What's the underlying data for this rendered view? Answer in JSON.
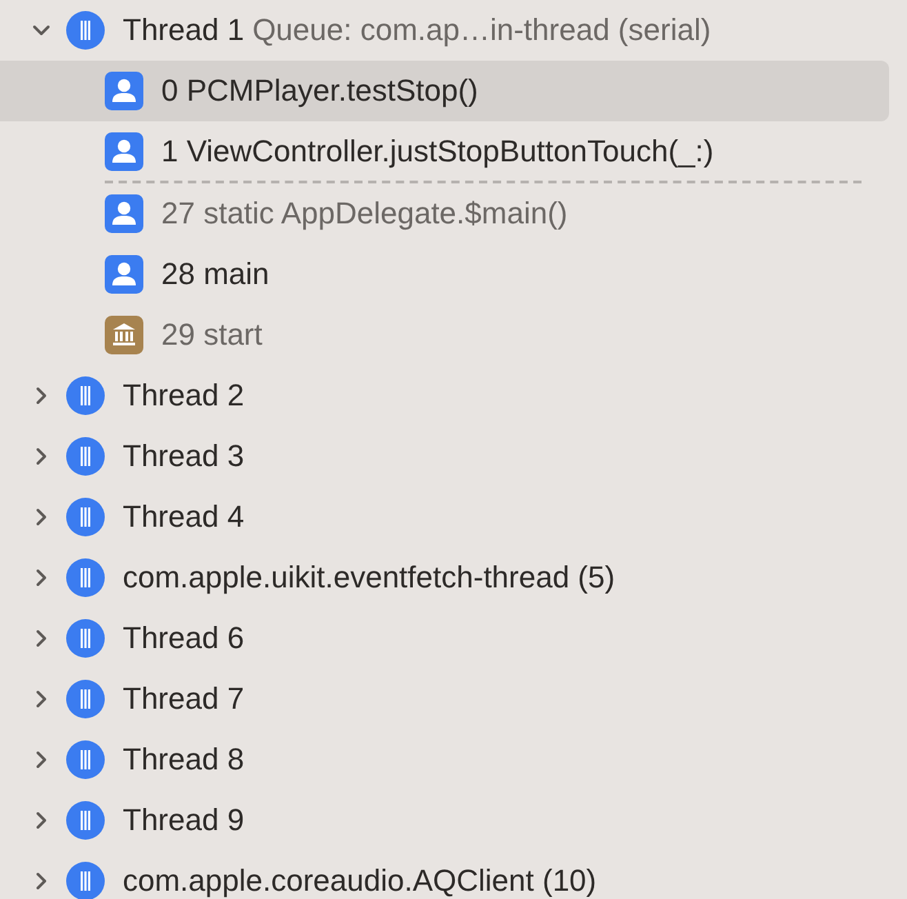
{
  "threads": [
    {
      "name": "Thread 1",
      "queue": "Queue: com.ap…in-thread (serial)",
      "expanded": true,
      "frames": [
        {
          "label": "0 PCMPlayer.testStop()",
          "kind": "user",
          "dimmed": false,
          "selected": true,
          "gap_after": false
        },
        {
          "label": "1 ViewController.justStopButtonTouch(_:)",
          "kind": "user",
          "dimmed": false,
          "selected": false,
          "gap_after": true
        },
        {
          "label": "27 static AppDelegate.$main()",
          "kind": "user",
          "dimmed": true,
          "selected": false,
          "gap_after": false
        },
        {
          "label": "28 main",
          "kind": "user",
          "dimmed": false,
          "selected": false,
          "gap_after": false
        },
        {
          "label": "29 start",
          "kind": "system",
          "dimmed": true,
          "selected": false,
          "gap_after": false
        }
      ]
    },
    {
      "name": "Thread 2",
      "expanded": false
    },
    {
      "name": "Thread 3",
      "expanded": false
    },
    {
      "name": "Thread 4",
      "expanded": false
    },
    {
      "name": "com.apple.uikit.eventfetch-thread (5)",
      "expanded": false
    },
    {
      "name": "Thread 6",
      "expanded": false
    },
    {
      "name": "Thread 7",
      "expanded": false
    },
    {
      "name": "Thread 8",
      "expanded": false
    },
    {
      "name": "Thread 9",
      "expanded": false
    },
    {
      "name": "com.apple.coreaudio.AQClient (10)",
      "expanded": false
    }
  ]
}
